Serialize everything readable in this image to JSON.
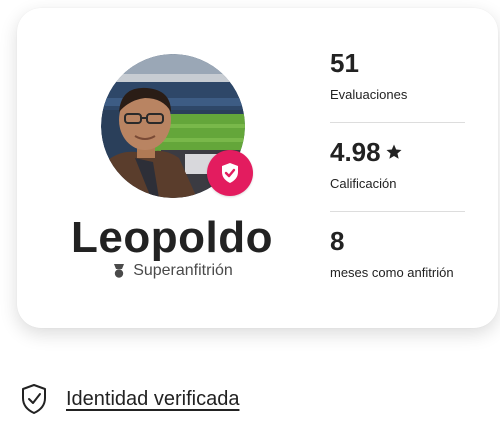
{
  "profile": {
    "name": "Leopoldo",
    "role": "Superanfitrión",
    "icons": {
      "avatar": "host-photo",
      "badge": "verified-shield-check-icon",
      "role_icon": "superhost-medal-icon"
    },
    "accent_color": "#e31c5f"
  },
  "stats": [
    {
      "value": "51",
      "label": "Evaluaciones"
    },
    {
      "value": "4.98",
      "icon": "star-icon",
      "label": "Calificación"
    },
    {
      "value": "8",
      "label": "meses como anfitrión"
    }
  ],
  "verification": {
    "icon": "shield-check-outline-icon",
    "link_text": "Identidad verificada"
  }
}
